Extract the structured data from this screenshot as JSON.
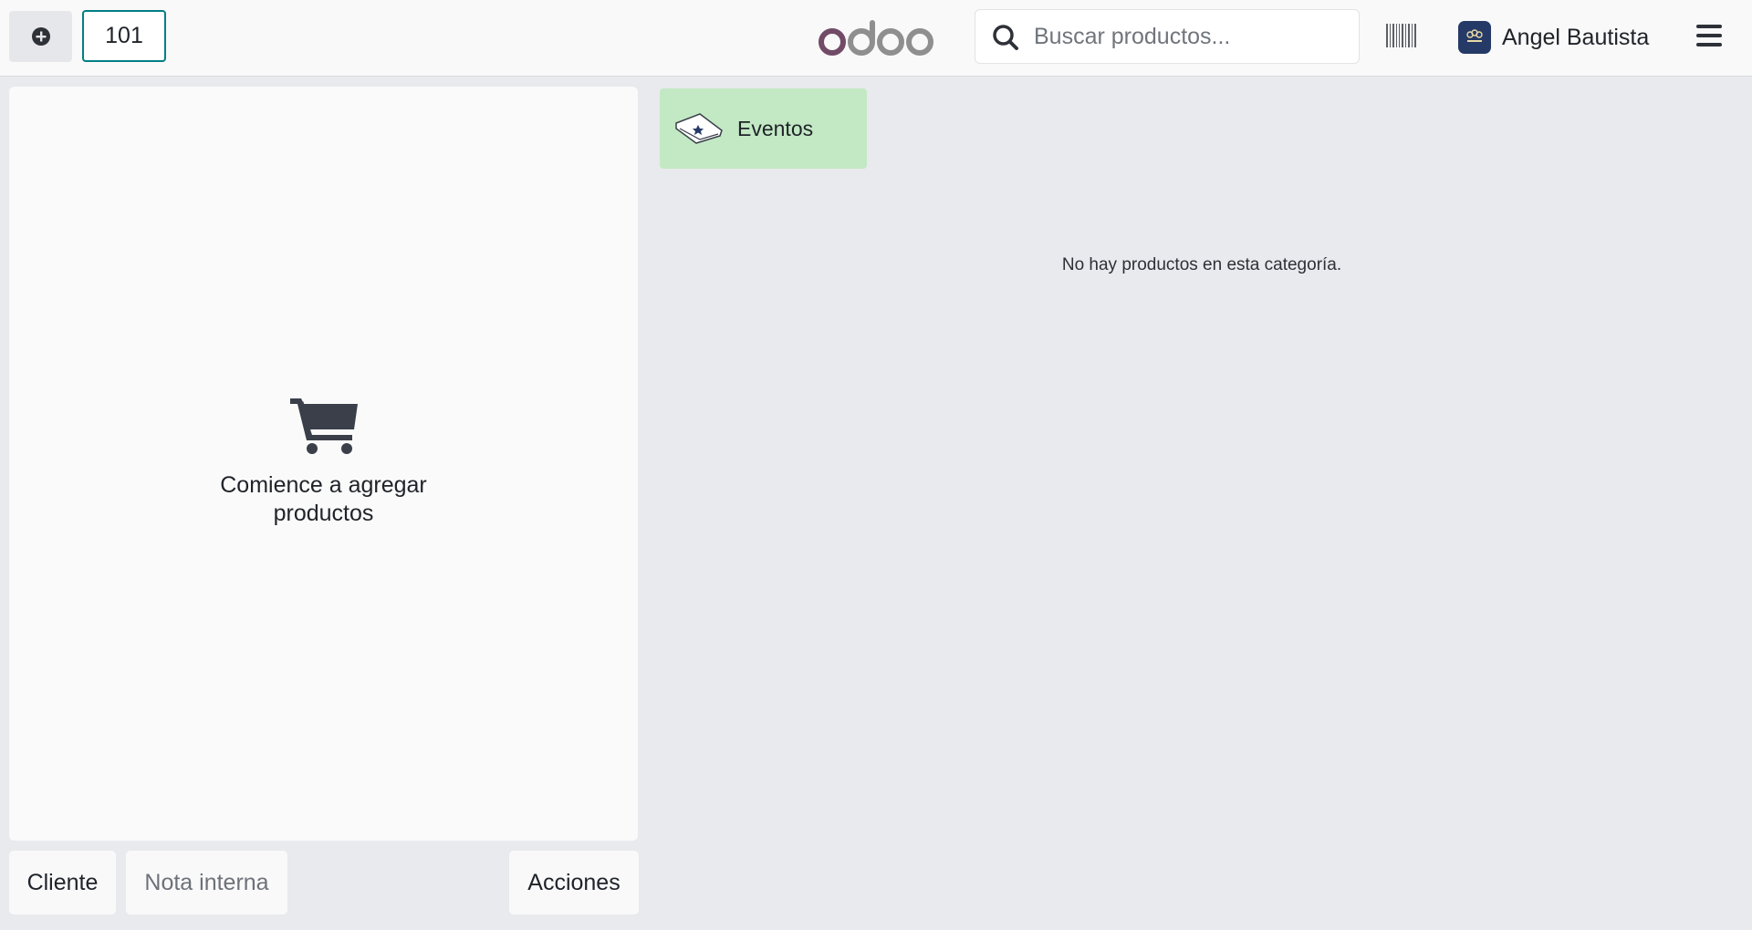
{
  "header": {
    "order_tab": "101",
    "logo_text": "odoo",
    "search_placeholder": "Buscar productos...",
    "user_name": "Angel Bautista"
  },
  "order_panel": {
    "empty_message": "Comience a agregar productos"
  },
  "buttons": {
    "cliente": "Cliente",
    "nota_interna": "Nota interna",
    "acciones": "Acciones"
  },
  "products": {
    "categories": [
      {
        "label": "Eventos"
      }
    ],
    "empty_message": "No hay productos en esta categoría."
  },
  "colors": {
    "accent": "#017e84",
    "logo_purple": "#714b67",
    "logo_gray": "#8f8f8f",
    "category_bg": "#c3e9c4"
  },
  "icons": [
    "plus-circle-icon",
    "search-icon",
    "barcode-icon",
    "hamburger-menu-icon",
    "shopping-cart-icon",
    "event-ticket-icon"
  ]
}
